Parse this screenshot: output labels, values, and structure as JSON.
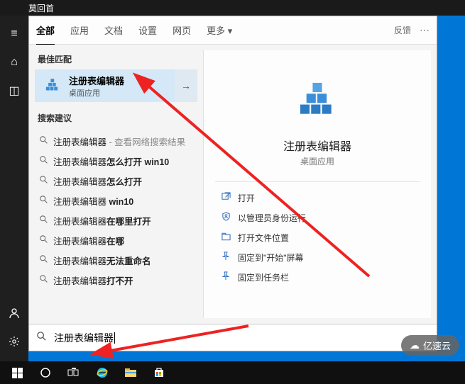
{
  "top_bar": {
    "title": "莫回首"
  },
  "tabs": {
    "all": "全部",
    "apps": "应用",
    "docs": "文档",
    "settings": "设置",
    "web": "网页",
    "more": "更多 ▾",
    "feedback": "反馈"
  },
  "left": {
    "best_match_header": "最佳匹配",
    "best_match": {
      "title": "注册表编辑器",
      "subtitle": "桌面应用"
    },
    "suggest_header": "搜索建议",
    "suggestions": [
      {
        "base": "注册表编辑器",
        "bold": "",
        "tail": " - 查看网络搜索结果"
      },
      {
        "base": "注册表编辑器",
        "bold": "怎么打开 win10",
        "tail": ""
      },
      {
        "base": "注册表编辑器",
        "bold": "怎么打开",
        "tail": ""
      },
      {
        "base": "注册表编辑器",
        "bold": " win10",
        "tail": ""
      },
      {
        "base": "注册表编辑器",
        "bold": "在哪里打开",
        "tail": ""
      },
      {
        "base": "注册表编辑器",
        "bold": "在哪",
        "tail": ""
      },
      {
        "base": "注册表编辑器",
        "bold": "无法重命名",
        "tail": ""
      },
      {
        "base": "注册表编辑器",
        "bold": "打不开",
        "tail": ""
      }
    ]
  },
  "right": {
    "title": "注册表编辑器",
    "subtitle": "桌面应用",
    "actions": [
      {
        "icon": "open",
        "label": "打开"
      },
      {
        "icon": "admin",
        "label": "以管理员身份运行"
      },
      {
        "icon": "folder",
        "label": "打开文件位置"
      },
      {
        "icon": "pin-start",
        "label": "固定到\"开始\"屏幕"
      },
      {
        "icon": "pin-task",
        "label": "固定到任务栏"
      }
    ]
  },
  "search_value": "注册表编辑器",
  "logo_text": "亿速云"
}
